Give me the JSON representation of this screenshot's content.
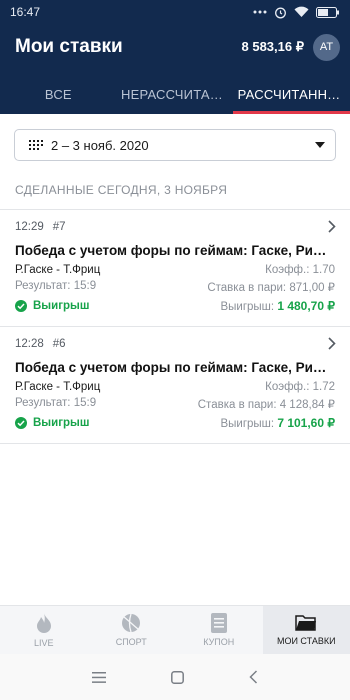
{
  "statusbar": {
    "time": "16:47"
  },
  "header": {
    "title": "Мои ставки",
    "balance": "8 583,16 ₽",
    "avatar_initials": "АТ"
  },
  "tabs": [
    {
      "label": "ВСЕ",
      "active": false
    },
    {
      "label": "НЕРАССЧИТАННЫЕ",
      "active": false
    },
    {
      "label": "РАССЧИТАННЫЕ",
      "active": true
    }
  ],
  "date_filter": {
    "value": "2 – 3 нояб. 2020"
  },
  "section_title": "СДЕЛАННЫЕ СЕГОДНЯ, 3 НОЯБРЯ",
  "bets": [
    {
      "time": "12:29",
      "number": "#7",
      "event": "Победа с учетом форы по геймам: Гаске, Ришар",
      "match": "Р.Гаске - Т.Фриц",
      "coef_label": "Коэфф.:",
      "coef": "1.70",
      "result_label": "Результат:",
      "result": "15:9",
      "stake_label": "Ставка в пари:",
      "stake": "871,00 ₽",
      "outcome": "Выигрыш",
      "payout_label": "Выигрыш:",
      "payout": "1 480,70 ₽"
    },
    {
      "time": "12:28",
      "number": "#6",
      "event": "Победа с учетом форы по геймам: Гаске, Ришар",
      "match": "Р.Гаске - Т.Фриц",
      "coef_label": "Коэфф.:",
      "coef": "1.72",
      "result_label": "Результат:",
      "result": "15:9",
      "stake_label": "Ставка в пари:",
      "stake": "4 128,84 ₽",
      "outcome": "Выигрыш",
      "payout_label": "Выигрыш:",
      "payout": "7 101,60 ₽"
    }
  ],
  "bottom_nav": [
    {
      "label": "LIVE",
      "icon": "flame-icon",
      "active": false
    },
    {
      "label": "СПОРТ",
      "icon": "ball-icon",
      "active": false
    },
    {
      "label": "КУПОН",
      "icon": "coupon-icon",
      "active": false
    },
    {
      "label": "МОИ СТАВКИ",
      "icon": "folder-icon",
      "active": true
    }
  ],
  "colors": {
    "header_bg": "#122a4e",
    "tab_indicator": "#e2394a",
    "win_green": "#17a34a"
  }
}
